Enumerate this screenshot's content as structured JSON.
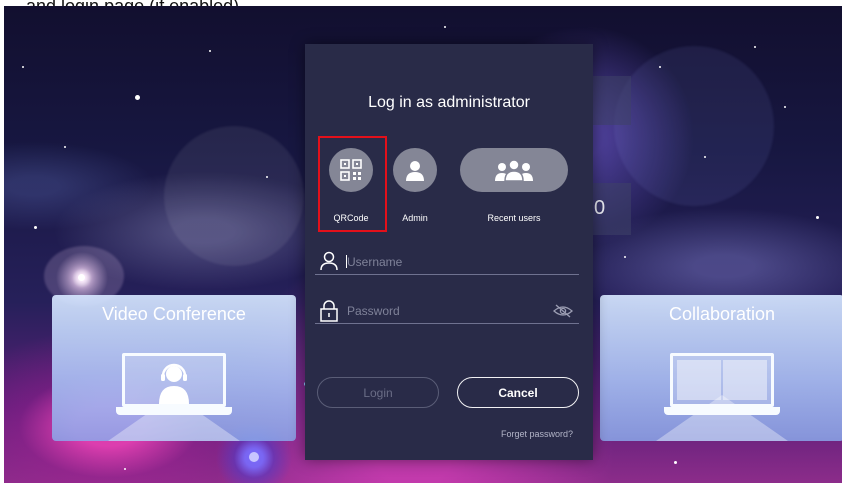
{
  "overlay_caption": "…and login page (if enabled)…",
  "background": {
    "tiles": {
      "video_conference": "Video Conference",
      "collaboration": "Collaboration"
    },
    "partial_digit": "0"
  },
  "dialog": {
    "title": "Log in as administrator",
    "login_options": [
      {
        "label": "QRCode",
        "icon": "qr-code-icon",
        "selected": true
      },
      {
        "label": "Admin",
        "icon": "user-icon",
        "selected": false
      },
      {
        "label": "Recent users",
        "icon": "users-group-icon",
        "selected": false
      }
    ],
    "username_placeholder": "Username",
    "password_placeholder": "Password",
    "login_button": "Login",
    "cancel_button": "Cancel",
    "forget_password": "Forget password?"
  },
  "colors": {
    "dialog_bg": "#292b48",
    "highlight": "#e3101a",
    "option_bg": "#848696"
  }
}
